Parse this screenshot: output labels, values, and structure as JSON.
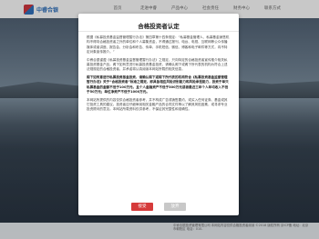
{
  "header": {
    "logo_text": "中睿合银",
    "nav": [
      "首页",
      "走进中睿",
      "产品中心",
      "社会责任",
      "财务中心",
      "联系方式"
    ]
  },
  "footer": {
    "text": "中睿合银投资管理有限公司 本网站内容仅供合格投资者阅读 ©2018 版权所有 京ICP备 地址：北京市朝阳区 电话：010-"
  },
  "modal": {
    "title": "合格投资者认定",
    "paragraphs": [
      "根据《私募投资基金监督管理暂行办法》第四章第十四条规定：“私募基金管理人、私募基金销售机构不得向合格投资者之外的单位和个人募集资金，不得通过报刊、电台、电视、互联网等公众传播媒体或者讲座、报告会、分析会和布告、传单、手机短信、微信、博客和电子邮件等方式，向不特定对象宣传推介。”",
      "中睿合银谨遵《私募投资基金监督管理暂行办法》之规定，只向特定的合格投资者宣传推介相关私募投资基金产品。阁下如有意进行私募投资基金投资，请确认阁下或阁下所代表的机构为符合上述法规规定的合格投资者，并承诺将认真阅读本网站所载的相关信息。",
      "阁下如有意进行私募投资基金投资，请确认阁下或阁下所代表的机构符合《私募投资基金监督管理暂行办法》关于“合格投资者”标准之规定，即具备相应风险识别能力和风险承担能力，投资于单只私募基金的金额不低于100万元，且个人金融资产不低于300万元或者最近三年个人年均收入不低于50万元；单位净资产不低于1000万元。",
      "本网站所提供的内容仅供合格投资者参考，并不构成广告或销售要约，或买入任何证券、基金或其它投资工具的建议。投资者应仔细审阅相关金融产品的合同文件等以了解其风险因素，或寻求专业投资顾问的意见。本网站所载资料仅供参考，不保证其完整性和准确性。"
    ],
    "agree_label": "接受",
    "disagree_label": "放弃"
  }
}
